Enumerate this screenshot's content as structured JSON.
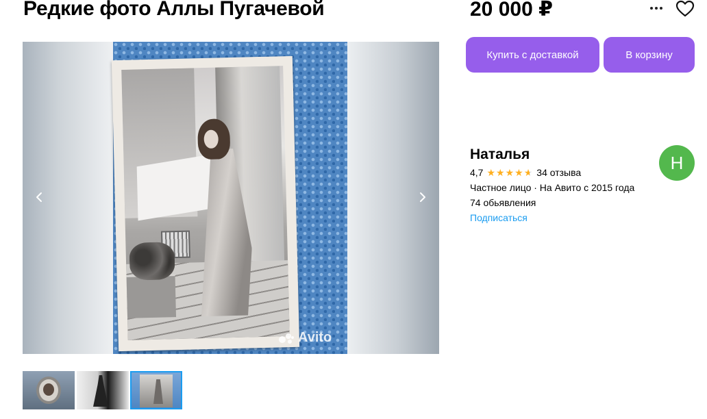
{
  "listing": {
    "title": "Редкие фото Аллы Пугачевой",
    "price": "20 000 ₽"
  },
  "header_icons": {
    "more": "more-dots-icon",
    "favorite": "heart-icon"
  },
  "actions": {
    "buy_with_delivery": "Купить с доставкой",
    "add_to_cart": "В корзину",
    "button_color": "#965eeb"
  },
  "gallery": {
    "watermark": "Avito",
    "prev_icon": "chevron-left-icon",
    "next_icon": "chevron-right-icon",
    "thumbnail_count": 3,
    "selected_thumbnail": 3
  },
  "seller": {
    "name": "Наталья",
    "rating": "4,7",
    "stars_filled": 4.7,
    "reviews": "34 отзыва",
    "info": "Частное лицо · На Авито с 2015 года",
    "ads": "74 обьявления",
    "subscribe": "Подписаться",
    "avatar_letter": "Н",
    "avatar_color": "#53b84d",
    "link_color": "#1a9cf0",
    "star_color": "#ffb021"
  }
}
